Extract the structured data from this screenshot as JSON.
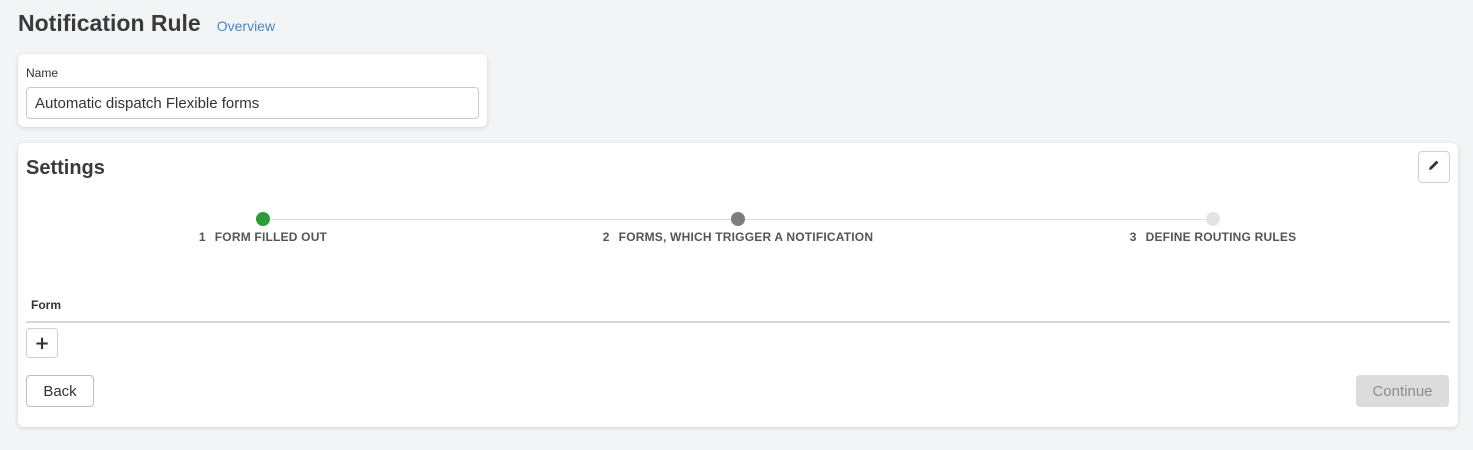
{
  "header": {
    "title": "Notification Rule",
    "overview_link": "Overview"
  },
  "name_section": {
    "label": "Name",
    "value": "Automatic dispatch Flexible forms"
  },
  "settings": {
    "title": "Settings",
    "edit_icon": "pencil-icon",
    "steps": [
      {
        "number": "1",
        "label": "FORM FILLED OUT",
        "state": "completed",
        "color": "#2e9a3a"
      },
      {
        "number": "2",
        "label": "FORMS, WHICH TRIGGER A NOTIFICATION",
        "state": "current",
        "color": "#7d7d7d"
      },
      {
        "number": "3",
        "label": "DEFINE ROUTING RULES",
        "state": "pending",
        "color": "#e4e4e4"
      }
    ],
    "form_column_header": "Form",
    "add_button_label": "+",
    "back_label": "Back",
    "continue_label": "Continue"
  },
  "colors": {
    "accent_link": "#4a86b8",
    "completed": "#2e9a3a",
    "background": "#f3f4f6"
  }
}
